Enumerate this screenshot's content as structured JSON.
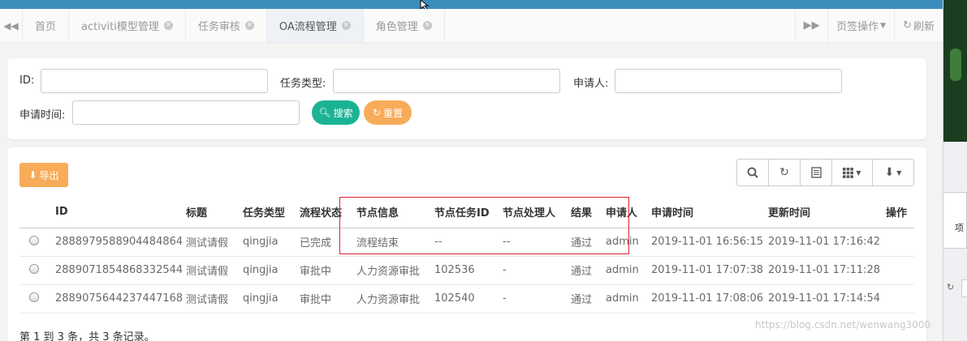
{
  "colors": {
    "topbar": "#3c8dbc",
    "search": "#1ab394",
    "warning": "#f8ac59",
    "highlight": "#d9232d"
  },
  "tabs": [
    {
      "label": "首页",
      "closable": false
    },
    {
      "label": "activiti模型管理",
      "closable": true
    },
    {
      "label": "任务审核",
      "closable": true
    },
    {
      "label": "OA流程管理",
      "closable": true,
      "active": true
    },
    {
      "label": "角色管理",
      "closable": true
    }
  ],
  "tabbar": {
    "page_ops": "页签操作",
    "refresh": "刷新"
  },
  "search": {
    "id_label": "ID:",
    "task_type_label": "任务类型:",
    "applicant_label": "申请人:",
    "apply_time_label": "申请时间:",
    "id_value": "",
    "task_type_value": "",
    "applicant_value": "",
    "apply_time_value": "",
    "search_button": "搜索",
    "reset_button": "重置"
  },
  "toolbar": {
    "export_button": "导出"
  },
  "table": {
    "columns": [
      "",
      "ID",
      "标题",
      "任务类型",
      "流程状态",
      "节点信息",
      "节点任务ID",
      "节点处理人",
      "结果",
      "申请人",
      "申请时间",
      "更新时间",
      "操作"
    ],
    "rows": [
      [
        "",
        "2888979588904484864",
        "测试请假",
        "qingjia",
        "已完成",
        "流程结束",
        "--",
        "--",
        "通过",
        "admin",
        "2019-11-01 16:56:15",
        "2019-11-01 17:16:42",
        ""
      ],
      [
        "",
        "2889071854868332544",
        "测试请假",
        "qingjia",
        "审批中",
        "人力资源审批",
        "102536",
        "-",
        "通过",
        "admin",
        "2019-11-01 17:07:38",
        "2019-11-01 17:11:28",
        ""
      ],
      [
        "",
        "2889075644237447168",
        "测试请假",
        "qingjia",
        "审批中",
        "人力资源审批",
        "102540",
        "-",
        "通过",
        "admin",
        "2019-11-01 17:08:06",
        "2019-11-01 17:14:54",
        ""
      ]
    ]
  },
  "pagination": {
    "info": "第 1 到 3 条，共 3 条记录。"
  },
  "watermark": "https://blog.csdn.net/wenwang3000",
  "side": {
    "partial_text": "项"
  }
}
